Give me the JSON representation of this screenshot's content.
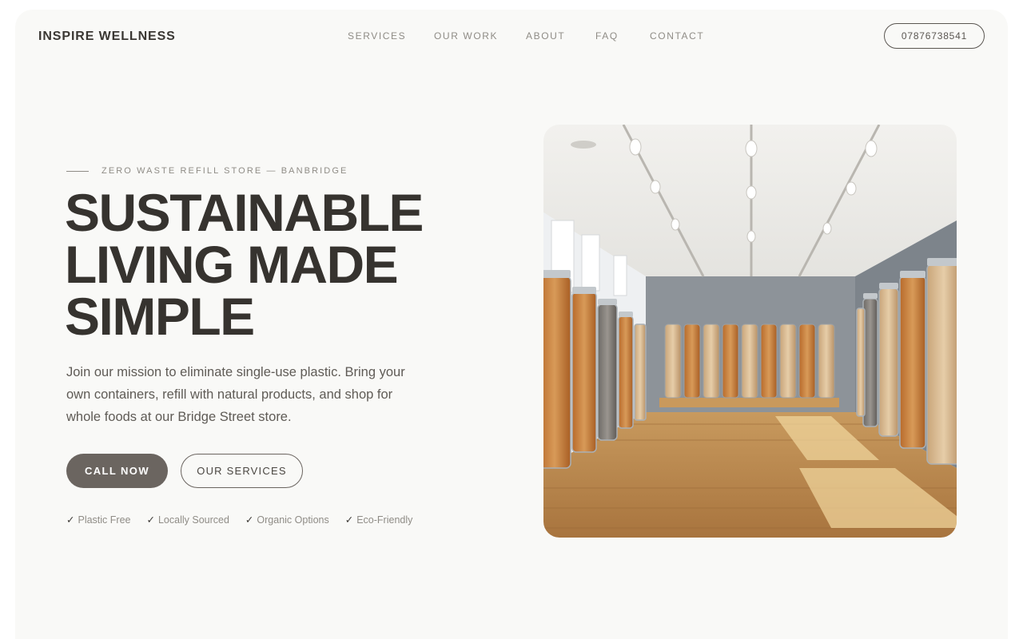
{
  "header": {
    "brand": "INSPIRE WELLNESS",
    "nav": [
      {
        "label": "SERVICES",
        "name": "nav-services"
      },
      {
        "label": "OUR WORK",
        "name": "nav-our-work"
      },
      {
        "label": "ABOUT",
        "name": "nav-about"
      },
      {
        "label": "FAQ",
        "name": "nav-faq"
      },
      {
        "label": "CONTACT",
        "name": "nav-contact"
      }
    ],
    "phone": "07876738541"
  },
  "hero": {
    "eyebrow": "ZERO WASTE REFILL STORE — BANBRIDGE",
    "headline": [
      "SUSTAINABLE",
      "LIVING MADE",
      "SIMPLE"
    ],
    "lead": "Join our mission to eliminate single-use plastic. Bring your own containers, refill with natural products, and shop for whole foods at our Bridge Street store.",
    "primary_button": "CALL NOW",
    "secondary_button": "OUR SERVICES",
    "features": [
      {
        "check": "✓",
        "label": "Plastic Free"
      },
      {
        "check": "✓",
        "label": "Locally Sourced"
      },
      {
        "check": "✓",
        "label": "Organic Options"
      },
      {
        "check": "✓",
        "label": "Eco-Friendly"
      }
    ],
    "image_icon": "store-interior-photo"
  },
  "colors": {
    "page_bg": "#f9f9f7",
    "text_dark": "#36332f",
    "text_muted": "#8f8c86",
    "button_fill": "#6b6560"
  }
}
